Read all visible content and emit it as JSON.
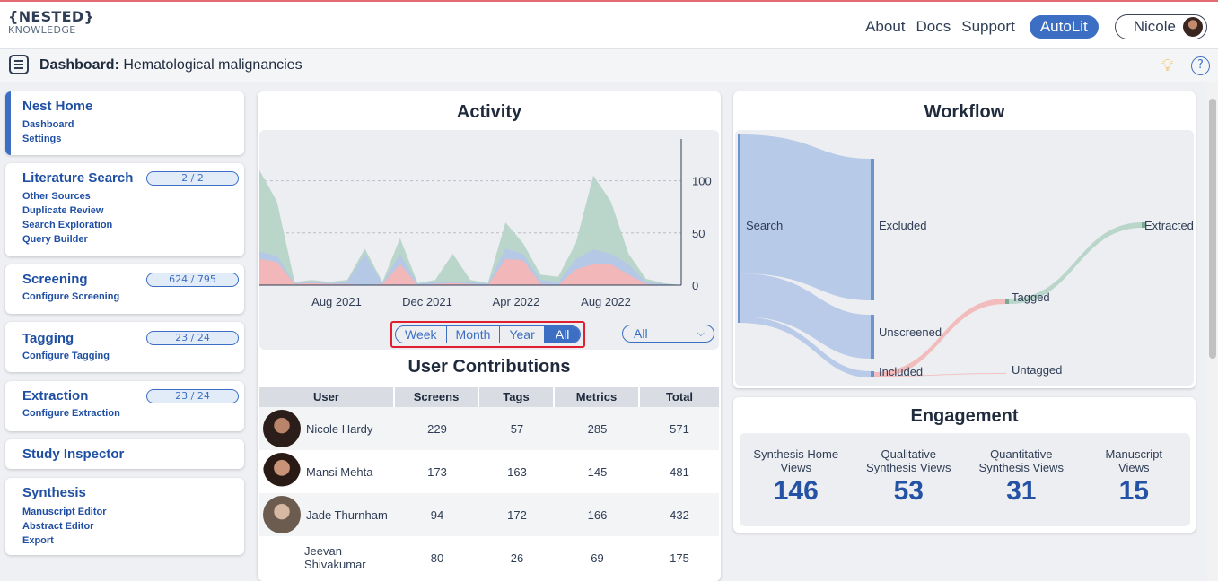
{
  "logo": {
    "line1": "{NESTED}",
    "line2": "KNOWLEDGE"
  },
  "nav": {
    "about": "About",
    "docs": "Docs",
    "support": "Support",
    "autolit": "AutoLit",
    "user": "Nicole"
  },
  "header": {
    "title_bold": "Dashboard:",
    "title_rest": " Hematological malignancies"
  },
  "sidebar": {
    "nest": {
      "title": "Nest Home",
      "items": [
        "Dashboard",
        "Settings"
      ]
    },
    "search": {
      "title": "Literature Search",
      "badge": "2 / 2",
      "items": [
        "Other Sources",
        "Duplicate Review",
        "Search Exploration",
        "Query Builder"
      ]
    },
    "screening": {
      "title": "Screening",
      "badge": "624 / 795",
      "items": [
        "Configure Screening"
      ]
    },
    "tagging": {
      "title": "Tagging",
      "badge": "23 / 24",
      "items": [
        "Configure Tagging"
      ]
    },
    "extraction": {
      "title": "Extraction",
      "badge": "23 / 24",
      "items": [
        "Configure Extraction"
      ]
    },
    "inspector": {
      "title": "Study Inspector"
    },
    "synthesis": {
      "title": "Synthesis",
      "items": [
        "Manuscript Editor",
        "Abstract Editor",
        "Export"
      ]
    }
  },
  "activity": {
    "title": "Activity",
    "range_buttons": [
      "Week",
      "Month",
      "Year",
      "All"
    ],
    "selected_range": "All",
    "filter": "All"
  },
  "chart_data": {
    "type": "area",
    "title": "Activity",
    "x_ticks": [
      "Aug 2021",
      "Dec 2021",
      "Apr 2022",
      "Aug 2022"
    ],
    "y_ticks": [
      "0",
      "50",
      "100"
    ],
    "ylim": [
      0,
      140
    ],
    "grid": true,
    "colors": {
      "screens": "#b4c7e7",
      "tags": "#f4b6b6",
      "metrics": "#b7d4c8"
    },
    "series": [
      {
        "color": "#f4b6b6",
        "values": [
          25,
          22,
          1,
          2,
          1,
          1,
          0,
          1,
          20,
          0,
          1,
          2,
          1,
          0,
          25,
          24,
          1,
          0,
          15,
          20,
          20,
          10,
          1,
          0,
          0
        ]
      },
      {
        "color": "#b4c7e7",
        "values": [
          32,
          28,
          2,
          3,
          2,
          3,
          30,
          2,
          30,
          1,
          3,
          3,
          3,
          1,
          35,
          30,
          5,
          3,
          25,
          34,
          30,
          20,
          3,
          1,
          0
        ]
      },
      {
        "color": "#b7d4c8",
        "values": [
          110,
          80,
          3,
          5,
          3,
          5,
          35,
          3,
          45,
          2,
          5,
          30,
          5,
          2,
          60,
          40,
          10,
          8,
          40,
          105,
          80,
          30,
          6,
          2,
          0
        ]
      }
    ]
  },
  "contributions": {
    "title": "User Contributions",
    "columns": [
      "User",
      "Screens",
      "Tags",
      "Metrics",
      "Total"
    ],
    "rows": [
      {
        "user": "Nicole Hardy",
        "screens": "229",
        "tags": "57",
        "metrics": "285",
        "total": "571"
      },
      {
        "user": "Mansi Mehta",
        "screens": "173",
        "tags": "163",
        "metrics": "145",
        "total": "481"
      },
      {
        "user": "Jade Thurnham",
        "screens": "94",
        "tags": "172",
        "metrics": "166",
        "total": "432"
      },
      {
        "user": "Jeevan Shivakumar",
        "screens": "80",
        "tags": "26",
        "metrics": "69",
        "total": "175"
      }
    ]
  },
  "workflow": {
    "title": "Workflow",
    "nodes": {
      "search": "Search",
      "excluded": "Excluded",
      "unscreened": "Unscreened",
      "included": "Included",
      "tagged": "Tagged",
      "untagged": "Untagged",
      "extracted": "Extracted"
    }
  },
  "engagement": {
    "title": "Engagement",
    "stats": [
      {
        "label1": "Synthesis Home",
        "label2": "Views",
        "value": "146"
      },
      {
        "label1": "Qualitative",
        "label2": "Synthesis Views",
        "value": "53"
      },
      {
        "label1": "Quantitative",
        "label2": "Synthesis Views",
        "value": "31"
      },
      {
        "label1": "Manuscript",
        "label2": "Views",
        "value": "15"
      }
    ]
  }
}
